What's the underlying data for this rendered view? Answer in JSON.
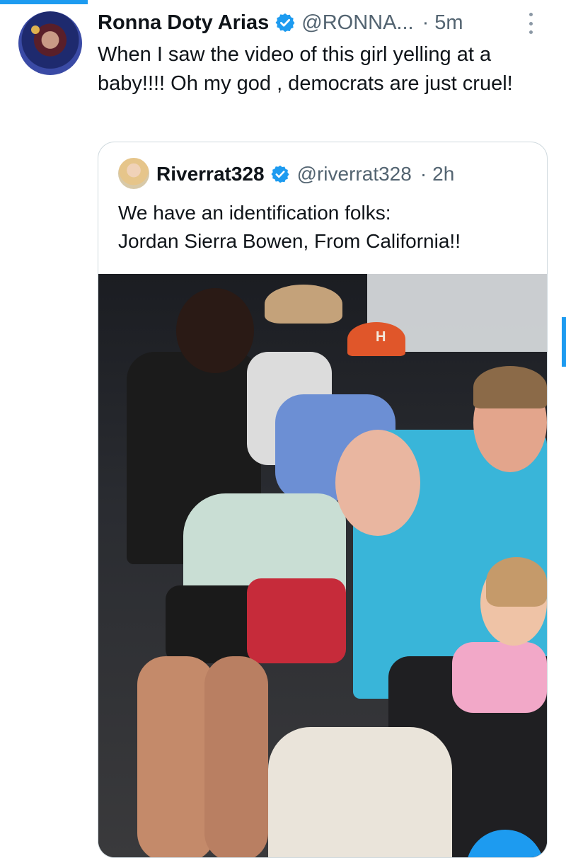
{
  "tweet": {
    "author_name": "Ronna Doty Arias",
    "author_handle": "@RONNA...",
    "separator": "·",
    "time": "5m",
    "text": "When I saw the video of this girl yelling at a baby!!!! Oh my god , democrats are just cruel!"
  },
  "quoted_tweet": {
    "author_name": "Riverrat328",
    "author_handle": "@riverrat328",
    "separator": "·",
    "time": "2h",
    "text_line1": "We have an identification folks:",
    "text_line2": "Jordan Sierra Bowen, From California!!"
  },
  "media": {
    "cap_letter": "H"
  },
  "colors": {
    "accent": "#1d9bf0",
    "text_primary": "#0f1419",
    "text_secondary": "#536471",
    "border": "#cfd9de"
  },
  "icons": {
    "verified": "verified-badge-icon",
    "more": "more-vertical-icon"
  }
}
